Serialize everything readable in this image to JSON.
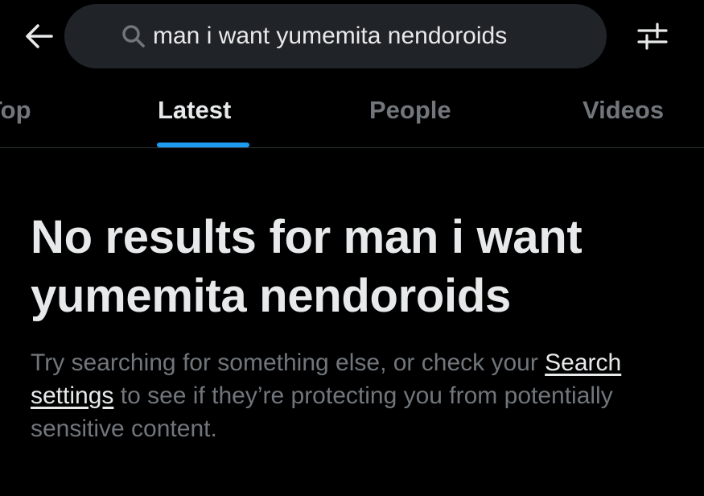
{
  "header": {
    "back_icon": "arrow-left-icon",
    "search": {
      "icon": "search-icon",
      "query": "man i want yumemita nendoroids"
    },
    "filter_icon": "sliders-icon"
  },
  "tabs": [
    {
      "label": "Top",
      "active": false
    },
    {
      "label": "Latest",
      "active": true
    },
    {
      "label": "People",
      "active": false
    },
    {
      "label": "Videos",
      "active": false
    }
  ],
  "empty_state": {
    "title": "No results for man i want yumemita nendoroids",
    "desc_prefix": "Try searching for something else, or check your",
    "link_label": "Search settings",
    "desc_suffix": "to see if they’re protecting you from potentially sensitive content."
  },
  "colors": {
    "background": "#000000",
    "search_bg": "#202327",
    "primary_text": "#e7e9ea",
    "secondary_text": "#71767b",
    "accent": "#1d9bf0",
    "divider": "#2f3336"
  }
}
